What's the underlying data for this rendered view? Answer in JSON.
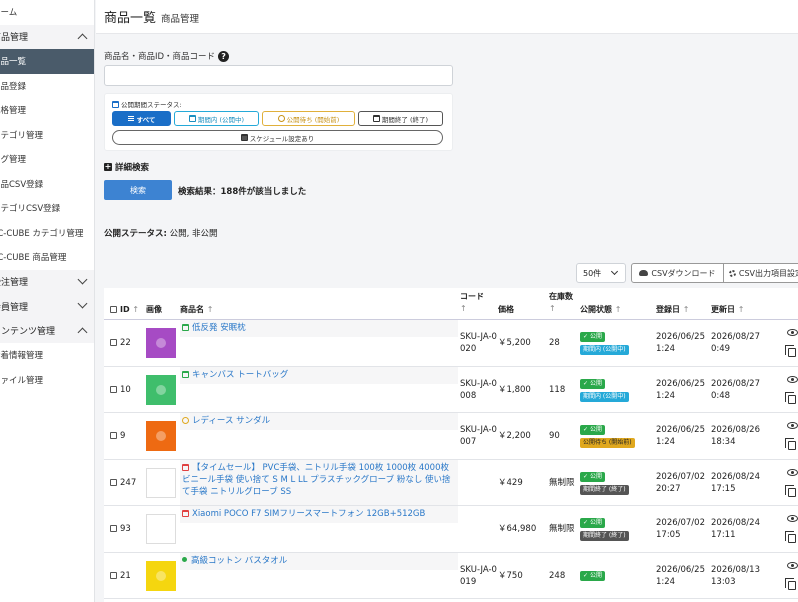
{
  "sidebar": {
    "items": [
      {
        "label": "ホーム",
        "type": "item"
      },
      {
        "label": "商品管理",
        "type": "group",
        "expanded": true
      },
      {
        "label": "商品一覧",
        "type": "item",
        "active": true
      },
      {
        "label": "商品登録",
        "type": "item"
      },
      {
        "label": "規格管理",
        "type": "item"
      },
      {
        "label": "カテゴリ管理",
        "type": "item"
      },
      {
        "label": "タグ管理",
        "type": "item"
      },
      {
        "label": "商品CSV登録",
        "type": "item"
      },
      {
        "label": "カテゴリCSV登録",
        "type": "item"
      },
      {
        "label": "EC-CUBE カテゴリ管理",
        "type": "item"
      },
      {
        "label": "EC-CUBE 商品管理",
        "type": "item"
      },
      {
        "label": "受注管理",
        "type": "group",
        "expanded": false
      },
      {
        "label": "会員管理",
        "type": "group",
        "expanded": false
      },
      {
        "label": "コンテンツ管理",
        "type": "group",
        "expanded": true
      },
      {
        "label": "新着情報管理",
        "type": "item"
      },
      {
        "label": "ファイル管理",
        "type": "item"
      }
    ]
  },
  "header": {
    "title": "商品一覧",
    "subtitle": "商品管理"
  },
  "search": {
    "label": "商品名・商品ID・商品コード",
    "value": ""
  },
  "status_filter": {
    "title": "公開期間ステータス:",
    "all": "すべて",
    "in_period": "期間内 (公開中)",
    "waiting": "公開待ち (開始前)",
    "ended": "期間終了 (終了)",
    "scheduled": "スケジュール設定あり"
  },
  "detail_search": "詳細検索",
  "search_button": "検索",
  "result_text": "検索結果：188件が該当しました",
  "public_status": {
    "label": "公開ステータス:",
    "value": " 公開, 非公開"
  },
  "per_page": "50件",
  "csv_download": "CSVダウンロード",
  "csv_settings": "CSV出力項目設定",
  "table": {
    "headers": {
      "id": "ID",
      "image": "画像",
      "name": "商品名",
      "code": "コード",
      "price": "価格",
      "stock": "在庫数",
      "status": "公開状態",
      "created": "登録日",
      "updated": "更新日"
    },
    "rows": [
      {
        "id": "22",
        "name": "低反発 安眠枕",
        "name_icon": "period",
        "code": "SKU-JA-0020",
        "price": "￥5,200",
        "stock": "28",
        "status": "公開",
        "period": "期間内 (公開中)",
        "period_type": "in",
        "created": "2026/06/25 1:24",
        "updated": "2026/08/27 0:49",
        "color": "#a64bc4"
      },
      {
        "id": "10",
        "name": "キャンバス トートバッグ",
        "name_icon": "period",
        "code": "SKU-JA-0008",
        "price": "￥1,800",
        "stock": "118",
        "status": "公開",
        "period": "期間内 (公開中)",
        "period_type": "in",
        "created": "2026/06/25 1:24",
        "updated": "2026/08/27 0:48",
        "color": "#3fbe6c"
      },
      {
        "id": "9",
        "name": "レディース サンダル",
        "name_icon": "wait",
        "code": "SKU-JA-0007",
        "price": "￥2,200",
        "stock": "90",
        "status": "公開",
        "period": "公開待ち (開始前)",
        "period_type": "wait",
        "created": "2026/06/25 1:24",
        "updated": "2026/08/26 18:34",
        "color": "#ee6a12"
      },
      {
        "id": "247",
        "name": "【タイムセール】 PVC手袋、ニトリル手袋 100枚 1000枚 4000枚 ビニール手袋 使い捨て S M L LL プラスチックグローブ 粉なし 使い捨て手袋 ニトリルグローブ SS",
        "name_icon": "end",
        "code": "",
        "price": "￥429",
        "stock": "無制限",
        "status": "公開",
        "period": "期間終了 (終了)",
        "period_type": "end",
        "created": "2026/07/02 20:27",
        "updated": "2026/08/24 17:15",
        "color": "#ffffff"
      },
      {
        "id": "93",
        "name": "Xiaomi POCO F7 SIMフリースマートフォン 12GB+512GB",
        "name_icon": "end",
        "code": "",
        "price": "￥64,980",
        "stock": "無制限",
        "status": "公開",
        "period": "期間終了 (終了)",
        "period_type": "end",
        "created": "2026/07/02 17:05",
        "updated": "2026/08/24 17:11",
        "color": "#ffffff"
      },
      {
        "id": "21",
        "name": "高級コットン バスタオル",
        "name_icon": "dot",
        "code": "SKU-JA-0019",
        "price": "￥750",
        "stock": "248",
        "status": "公開",
        "period": "",
        "period_type": "",
        "created": "2026/06/25 1:24",
        "updated": "2026/08/13 13:03",
        "color": "#f5d60f"
      }
    ]
  }
}
